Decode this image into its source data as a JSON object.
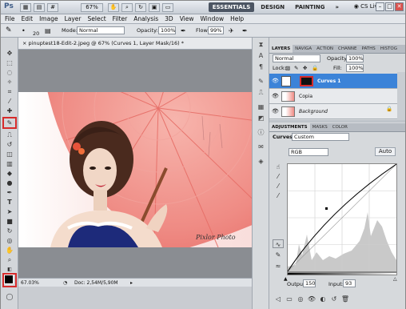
{
  "app": {
    "logo": "Ps",
    "zoom": "67%",
    "workspaces": [
      "ESSENTIALS",
      "DESIGN",
      "PAINTING"
    ],
    "more": "»",
    "cs_live": "CS Live"
  },
  "menu": [
    "File",
    "Edit",
    "Image",
    "Layer",
    "Select",
    "Filter",
    "Analysis",
    "3D",
    "View",
    "Window",
    "Help"
  ],
  "options": {
    "brush_size": "20",
    "mode_label": "Mode:",
    "mode_value": "Normal",
    "opacity_label": "Opacity:",
    "opacity_value": "100%",
    "flow_label": "Flow:",
    "flow_value": "99%"
  },
  "document": {
    "tab_title": "pinuptest18-Edit-2.jpeg @ 67% (Curves 1, Layer Mask/16) *",
    "watermark": "Pixlor Photo",
    "status_zoom": "67.03%",
    "status_doc": "Doc: 2,54M/5,90M"
  },
  "layers_panel": {
    "tabs": [
      "LAYERS",
      "NAVIGA",
      "ACTION",
      "CHANNE",
      "PATHS",
      "HISTOG"
    ],
    "blend_mode": "Normal",
    "opacity_label": "Opacity:",
    "opacity_value": "100%",
    "lock_label": "Lock:",
    "fill_label": "Fill:",
    "fill_value": "100%",
    "layers": [
      {
        "name": "Curves 1",
        "selected": true
      },
      {
        "name": "Copia",
        "selected": false
      },
      {
        "name": "Background",
        "selected": false
      }
    ]
  },
  "adjustments_panel": {
    "tabs": [
      "ADJUSTMENTS",
      "MASKS",
      "COLOR"
    ],
    "preset_label": "Curves",
    "preset_value": "Custom",
    "channel": "RGB",
    "auto_label": "Auto",
    "output_label": "Output:",
    "output_value": "150",
    "input_label": "Input:",
    "input_value": "93"
  },
  "colors": {
    "accent_select": "#3b83d8",
    "highlight_red": "#d62b2b"
  }
}
